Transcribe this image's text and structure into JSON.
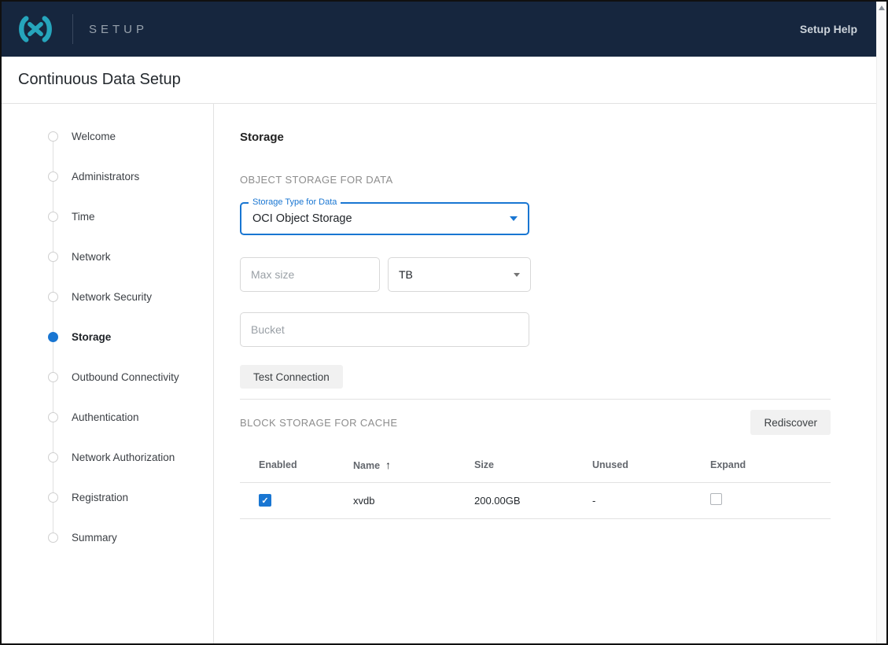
{
  "header": {
    "brand": "SETUP",
    "help_label": "Setup Help"
  },
  "page": {
    "title": "Continuous Data Setup"
  },
  "stepper": {
    "items": [
      {
        "label": "Welcome",
        "active": false
      },
      {
        "label": "Administrators",
        "active": false
      },
      {
        "label": "Time",
        "active": false
      },
      {
        "label": "Network",
        "active": false
      },
      {
        "label": "Network Security",
        "active": false
      },
      {
        "label": "Storage",
        "active": true
      },
      {
        "label": "Outbound Connectivity",
        "active": false
      },
      {
        "label": "Authentication",
        "active": false
      },
      {
        "label": "Network Authorization",
        "active": false
      },
      {
        "label": "Registration",
        "active": false
      },
      {
        "label": "Summary",
        "active": false
      }
    ]
  },
  "main": {
    "heading": "Storage",
    "object_storage": {
      "section_label": "OBJECT STORAGE FOR DATA",
      "storage_type": {
        "label": "Storage Type for Data",
        "value": "OCI Object Storage"
      },
      "max_size_placeholder": "Max size",
      "unit_value": "TB",
      "bucket_placeholder": "Bucket",
      "test_connection_label": "Test Connection"
    },
    "block_storage": {
      "section_label": "BLOCK STORAGE FOR CACHE",
      "rediscover_label": "Rediscover",
      "table": {
        "columns": [
          "Enabled",
          "Name",
          "Size",
          "Unused",
          "Expand"
        ],
        "sort_column": "Name",
        "sort_direction": "asc",
        "rows": [
          {
            "enabled": true,
            "name": "xvdb",
            "size": "200.00GB",
            "unused": "-",
            "expand": false
          }
        ]
      }
    }
  },
  "colors": {
    "header_bg": "#16263e",
    "accent_blue": "#1976d2",
    "logo_teal": "#26a5bc",
    "status_none": "#e2e2e2"
  }
}
